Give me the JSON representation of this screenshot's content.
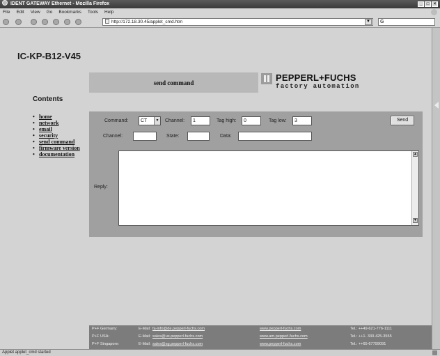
{
  "window": {
    "title": "IDENT GATEWAY Ethernet - Mozilla Firefox",
    "controls": [
      "_",
      "□",
      "×"
    ]
  },
  "menu": [
    "File",
    "Edit",
    "View",
    "Go",
    "Bookmarks",
    "Tools",
    "Help"
  ],
  "toolbar": {
    "url": "http://172.18.30.45/applet_cmd.htm",
    "search_value": "G"
  },
  "sidebar": {
    "device_title": "IC-KP-B12-V45",
    "contents_heading": "Contents",
    "items": [
      {
        "label": "home"
      },
      {
        "label": "network"
      },
      {
        "label": "email"
      },
      {
        "label": "security"
      },
      {
        "label": "send command"
      },
      {
        "label": "firmware version"
      },
      {
        "label": "documentation"
      }
    ]
  },
  "header": {
    "section_title": "send command",
    "brand_name": "PEPPERL+FUCHS",
    "brand_tagline": "factory automation"
  },
  "form": {
    "command_label": "Command:",
    "command_value": "CT",
    "channel_label": "Channel:",
    "channel_value": "1",
    "tag_high_label": "Tag high:",
    "tag_high_value": "0",
    "tag_low_label": "Tag low:",
    "tag_low_value": "3",
    "send_label": "Send",
    "channel2_label": "Channel:",
    "channel2_value": "",
    "state_label": "State:",
    "state_value": "",
    "data_label": "Data:",
    "data_value": "",
    "reply_label": "Reply:",
    "reply_value": ""
  },
  "footer": {
    "rows": [
      {
        "country": "P+F Germany:",
        "email_prefix": "E-Mail:",
        "email": "fa-info@de.pepperl-fuchs.com",
        "web": "www.pepperl-fuchs.com",
        "tel": "Tel.: ++49-621-776-1111"
      },
      {
        "country": "P+F USA:",
        "email_prefix": "E-Mail:",
        "email": "sales@us.pepperl-fuchs.com",
        "web": "www.am.pepperl-fuchs.com",
        "tel": "Tel.: ++1- 330-425-3555"
      },
      {
        "country": "P+F Singapore:",
        "email_prefix": "E-Mail:",
        "email": "sales@sg.pepperl-fuchs.com",
        "web": "www.pepperl-fuchs.com",
        "tel": "Tel.: ++65-67799091"
      }
    ]
  },
  "status": {
    "text": "Applet applet_cmd started"
  }
}
